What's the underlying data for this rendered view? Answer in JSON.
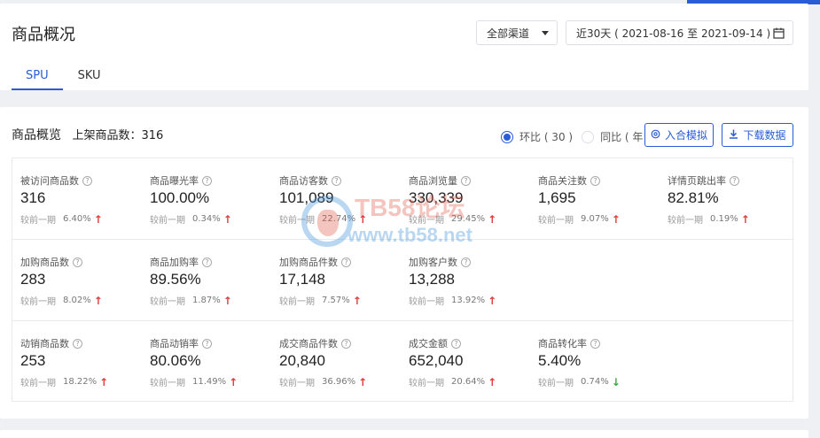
{
  "header": {
    "title": "商品概况",
    "channel_select": "全部渠道",
    "date_range": "近30天 ( 2021-08-16 至 2021-09-14 )"
  },
  "tabs": [
    {
      "label": "SPU",
      "active": true
    },
    {
      "label": "SKU",
      "active": false
    }
  ],
  "overview": {
    "title": "商品概览",
    "listed_count_label": "上架商品数：316",
    "compare_options": [
      {
        "label": "环比 ( 30 )",
        "checked": true
      },
      {
        "label": "同比 ( 年 )",
        "checked": false
      }
    ],
    "simulate_button": "入合模拟",
    "download_button": "下载数据",
    "compare_prefix": "较前一期",
    "rows": [
      [
        {
          "name": "被访问商品数",
          "value": "316",
          "change": "6.40%",
          "trend": "up"
        },
        {
          "name": "商品曝光率",
          "value": "100.00%",
          "change": "0.34%",
          "trend": "up"
        },
        {
          "name": "商品访客数",
          "value": "101,089",
          "change": "22.74%",
          "trend": "up"
        },
        {
          "name": "商品浏览量",
          "value": "330,339",
          "change": "29.45%",
          "trend": "up"
        },
        {
          "name": "商品关注数",
          "value": "1,695",
          "change": "9.07%",
          "trend": "up"
        },
        {
          "name": "详情页跳出率",
          "value": "82.81%",
          "change": "0.19%",
          "trend": "up"
        }
      ],
      [
        {
          "name": "加购商品数",
          "value": "283",
          "change": "8.02%",
          "trend": "up"
        },
        {
          "name": "商品加购率",
          "value": "89.56%",
          "change": "1.87%",
          "trend": "up"
        },
        {
          "name": "加购商品件数",
          "value": "17,148",
          "change": "7.57%",
          "trend": "up"
        },
        {
          "name": "加购客户数",
          "value": "13,288",
          "change": "13.92%",
          "trend": "up"
        }
      ],
      [
        {
          "name": "动销商品数",
          "value": "253",
          "change": "18.22%",
          "trend": "up"
        },
        {
          "name": "商品动销率",
          "value": "80.06%",
          "change": "11.49%",
          "trend": "up"
        },
        {
          "name": "成交商品件数",
          "value": "20,840",
          "change": "36.96%",
          "trend": "up"
        },
        {
          "name": "成交金额",
          "value": "652,040",
          "change": "20.64%",
          "trend": "up"
        },
        {
          "name": "商品转化率",
          "value": "5.40%",
          "change": "0.74%",
          "trend": "down"
        }
      ]
    ]
  },
  "watermark": {
    "line1": "TB58论坛",
    "line2": "www.tb58.net"
  },
  "colors": {
    "accent": "#2a5cd8",
    "up": "#e23b3b",
    "down": "#3aa845"
  }
}
